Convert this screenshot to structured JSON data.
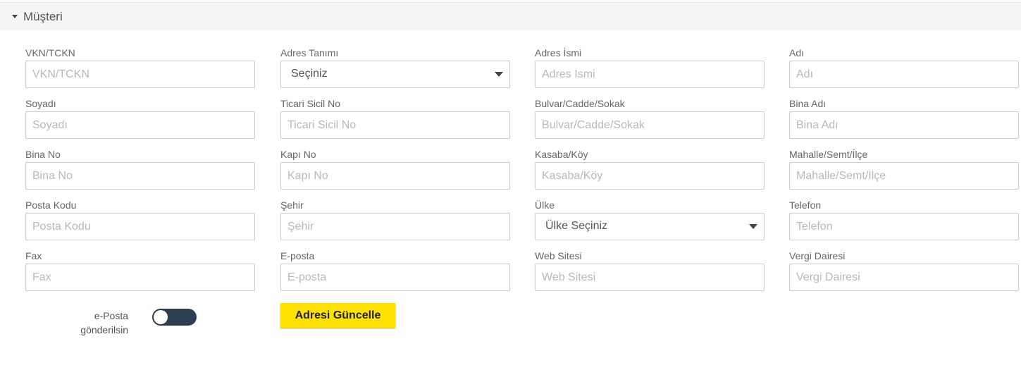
{
  "panel": {
    "title": "Müşteri"
  },
  "fields": [
    {
      "id": "vkn",
      "label": "VKN/TCKN",
      "placeholder": "VKN/TCKN"
    },
    {
      "id": "adres_tanimi",
      "label": "Adres Tanımı",
      "selected": "Seçiniz"
    },
    {
      "id": "adres_ismi",
      "label": "Adres İsmi",
      "placeholder": "Adres İsmi"
    },
    {
      "id": "adi",
      "label": "Adı",
      "placeholder": "Adı"
    },
    {
      "id": "soyadi",
      "label": "Soyadı",
      "placeholder": "Soyadı"
    },
    {
      "id": "ticari_sicil",
      "label": "Ticari Sicil No",
      "placeholder": "Ticari Sicil No"
    },
    {
      "id": "bulvar",
      "label": "Bulvar/Cadde/Sokak",
      "placeholder": "Bulvar/Cadde/Sokak"
    },
    {
      "id": "bina_adi",
      "label": "Bina Adı",
      "placeholder": "Bina Adı"
    },
    {
      "id": "bina_no",
      "label": "Bina No",
      "placeholder": "Bina No"
    },
    {
      "id": "kapi_no",
      "label": "Kapı No",
      "placeholder": "Kapı No"
    },
    {
      "id": "kasaba",
      "label": "Kasaba/Köy",
      "placeholder": "Kasaba/Köy"
    },
    {
      "id": "mahalle",
      "label": "Mahalle/Semt/İlçe",
      "placeholder": "Mahalle/Semt/İlçe"
    },
    {
      "id": "posta_kodu",
      "label": "Posta Kodu",
      "placeholder": "Posta Kodu"
    },
    {
      "id": "sehir",
      "label": "Şehir",
      "placeholder": "Şehir"
    },
    {
      "id": "ulke",
      "label": "Ülke",
      "selected": "Ülke Seçiniz"
    },
    {
      "id": "telefon",
      "label": "Telefon",
      "placeholder": "Telefon"
    },
    {
      "id": "fax",
      "label": "Fax",
      "placeholder": "Fax"
    },
    {
      "id": "eposta",
      "label": "E-posta",
      "placeholder": "E-posta"
    },
    {
      "id": "web",
      "label": "Web Sitesi",
      "placeholder": "Web Sitesi"
    },
    {
      "id": "vergi_dairesi",
      "label": "Vergi Dairesi",
      "placeholder": "Vergi Dairesi"
    }
  ],
  "toggle": {
    "label_line1": "e-Posta",
    "label_line2": "gönderilsin",
    "on": false
  },
  "submit": {
    "label": "Adresi Güncelle"
  },
  "colors": {
    "accent": "#ffe200",
    "toggle_track": "#2c3e50"
  }
}
